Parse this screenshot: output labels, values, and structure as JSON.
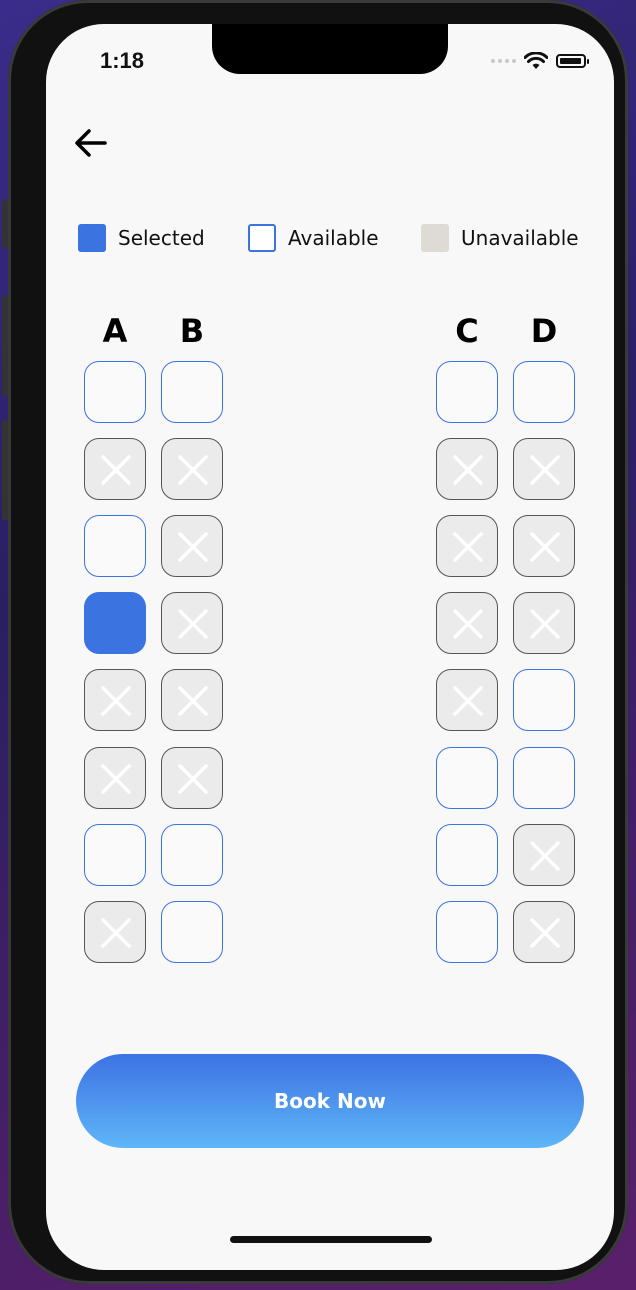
{
  "status_bar": {
    "time": "1:18"
  },
  "legend": [
    {
      "label": "Selected",
      "state": "selected"
    },
    {
      "label": "Available",
      "state": "available"
    },
    {
      "label": "Unavailable",
      "state": "unavailable"
    }
  ],
  "columns": [
    "A",
    "B",
    "C",
    "D"
  ],
  "seats": [
    [
      "available",
      "available",
      "available",
      "available"
    ],
    [
      "unavailable",
      "unavailable",
      "unavailable",
      "unavailable"
    ],
    [
      "available",
      "unavailable",
      "unavailable",
      "unavailable"
    ],
    [
      "selected",
      "unavailable",
      "unavailable",
      "unavailable"
    ],
    [
      "unavailable",
      "unavailable",
      "unavailable",
      "available"
    ],
    [
      "unavailable",
      "unavailable",
      "available",
      "available"
    ],
    [
      "available",
      "available",
      "available",
      "unavailable"
    ],
    [
      "unavailable",
      "available",
      "available",
      "unavailable"
    ]
  ],
  "book_button": {
    "label": "Book Now"
  },
  "colors": {
    "accent": "#3b73e0",
    "unavailable_fill": "#ebebeb",
    "legend_unavailable": "#dedad4",
    "button_gradient_top": "#3d72e3",
    "button_gradient_bottom": "#5eb6f7"
  },
  "icons": {
    "back": "arrow-left-icon",
    "wifi": "wifi-icon",
    "battery": "battery-icon",
    "unavailable_seat": "close-icon"
  }
}
